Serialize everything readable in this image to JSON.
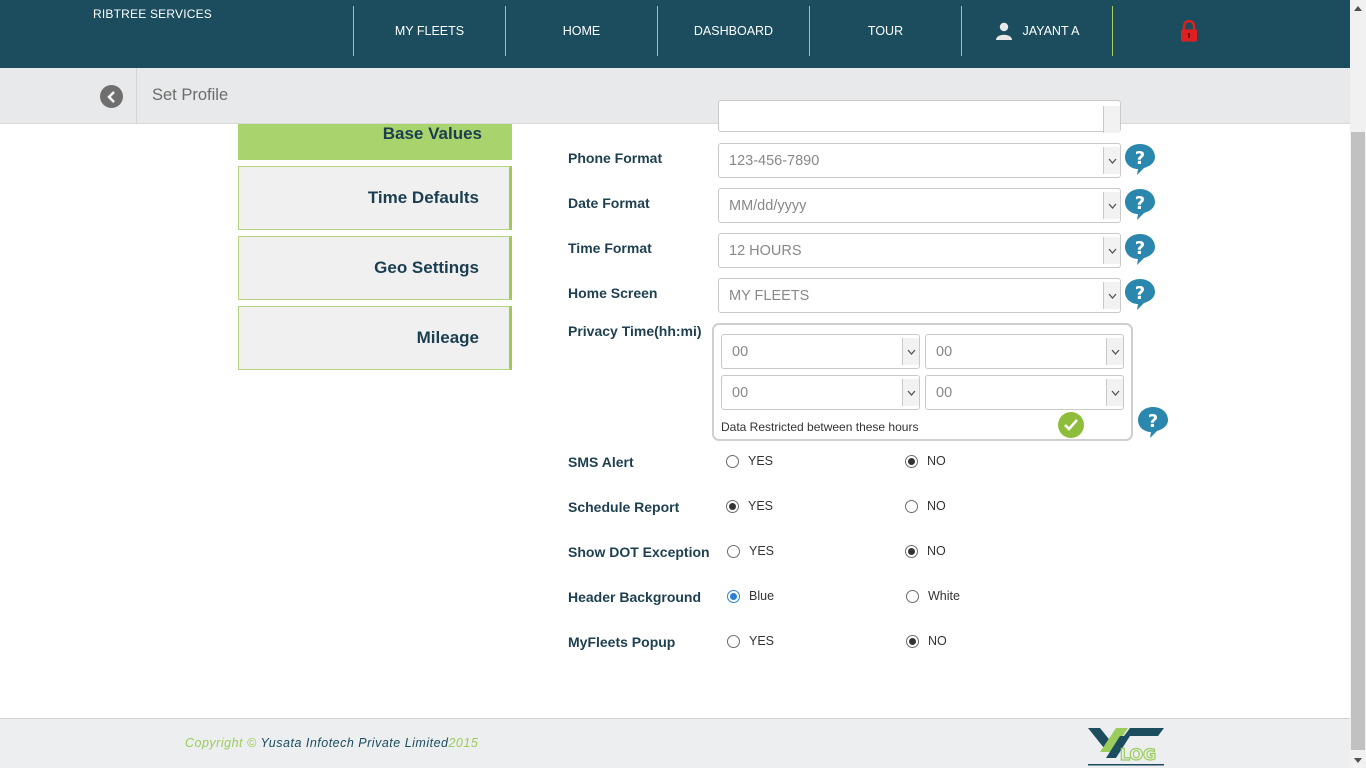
{
  "header": {
    "brand": "RIBTREE SERVICES",
    "nav": [
      "MY FLEETS",
      "HOME",
      "DASHBOARD",
      "TOUR"
    ],
    "user": "JAYANT A",
    "user_icon": "user-icon",
    "logout_icon": "lock-icon"
  },
  "subheader": {
    "title": "Set Profile",
    "back_icon": "back-arrow-icon"
  },
  "tabs": [
    "Base Values",
    "Time Defaults",
    "Geo Settings",
    "Mileage"
  ],
  "form": {
    "phone_format": {
      "label": "Phone Format",
      "value": "123-456-7890"
    },
    "date_format": {
      "label": "Date Format",
      "value": "MM/dd/yyyy"
    },
    "time_format": {
      "label": "Time Format",
      "value": "12 HOURS"
    },
    "home_screen": {
      "label": "Home Screen",
      "value": "MY FLEETS"
    },
    "privacy_time": {
      "label": "Privacy Time(hh:mi)",
      "start_hh": "00",
      "start_mi": "00",
      "end_hh": "00",
      "end_mi": "00",
      "note": "Data Restricted between these hours"
    },
    "sms_alert": {
      "label": "SMS Alert",
      "option_a": "YES",
      "option_b": "NO",
      "selected": "NO"
    },
    "schedule_report": {
      "label": "Schedule Report",
      "option_a": "YES",
      "option_b": "NO",
      "selected": "YES"
    },
    "show_dot_exception": {
      "label": "Show DOT Exception",
      "option_a": "YES",
      "option_b": "NO",
      "selected": "NO"
    },
    "header_background": {
      "label": "Header Background",
      "option_a": "Blue",
      "option_b": "White",
      "selected": "Blue"
    },
    "myfleets_popup": {
      "label": "MyFleets Popup",
      "option_a": "YES",
      "option_b": "NO",
      "selected": "NO"
    }
  },
  "footer": {
    "copyright_prefix": "Copyright ©",
    "company": "Yusata Infotech Private Limited",
    "year": "2015",
    "logo_text": "LOG"
  },
  "colors": {
    "header_bg": "#1b4d5f",
    "accent_green": "#a9d36d",
    "label_text": "#1d3f4f"
  }
}
